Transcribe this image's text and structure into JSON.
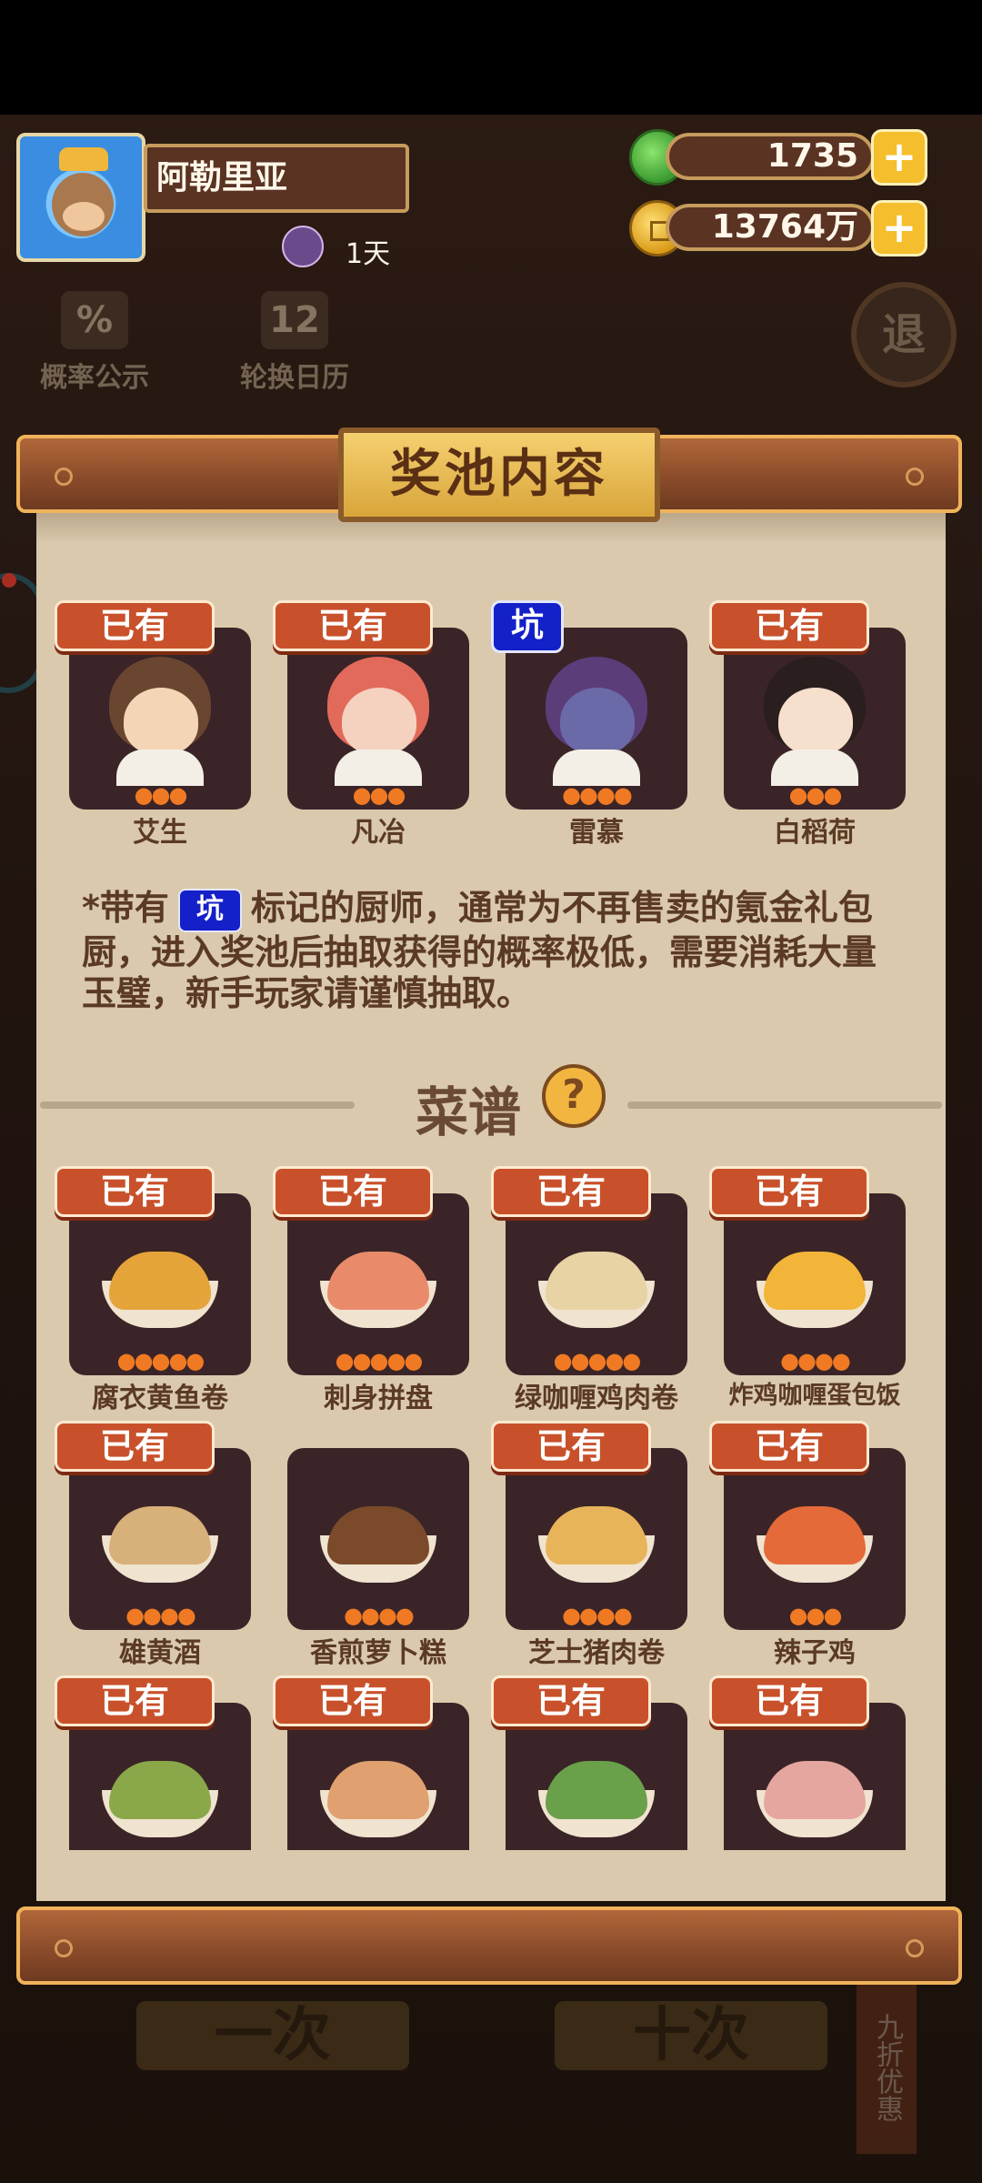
{
  "header": {
    "player_name": "阿勒里亚",
    "days": "1天",
    "jade_amount": "1735",
    "coin_amount": "13764万",
    "plus_symbol": "+"
  },
  "shortcuts": [
    {
      "label": "概率公示",
      "icon": "%"
    },
    {
      "label": "轮换日历",
      "icon": "12"
    }
  ],
  "exit_label": "退",
  "panel": {
    "title": "奖池内容",
    "chef_cards": [
      {
        "name": "艾生",
        "tag": "已有",
        "stars": "●●●"
      },
      {
        "name": "凡冶",
        "tag": "已有",
        "stars": "●●●"
      },
      {
        "name": "雷慕",
        "tag": "坑",
        "stars": "●●●●"
      },
      {
        "name": "白稻荷",
        "tag": "已有",
        "stars": "●●●"
      }
    ],
    "note_parts": [
      "*带有",
      "坑",
      "标记的厨师，通常为不再售卖的氪金礼包厨，进入奖池后抽取获得的概率极低，需要消耗大量玉璧，新手玩家请谨慎抽取。"
    ],
    "section_title": "菜谱",
    "help_symbol": "?",
    "recipes": [
      {
        "name": "腐衣黄鱼卷",
        "tag": "已有",
        "stars": "●●●●●",
        "color": "#e5a43a"
      },
      {
        "name": "刺身拼盘",
        "tag": "已有",
        "stars": "●●●●●",
        "color": "#e98b6a"
      },
      {
        "name": "绿咖喱鸡肉卷",
        "tag": "已有",
        "stars": "●●●●●",
        "color": "#e7d3a4"
      },
      {
        "name": "炸鸡咖喱蛋包饭",
        "tag": "已有",
        "stars": "●●●●",
        "color": "#f2b53a"
      },
      {
        "name": "雄黄酒",
        "tag": "已有",
        "stars": "●●●●",
        "color": "#d8b07a"
      },
      {
        "name": "香煎萝卜糕",
        "tag": "",
        "stars": "●●●●",
        "color": "#7a4a2a"
      },
      {
        "name": "芝士猪肉卷",
        "tag": "已有",
        "stars": "●●●●",
        "color": "#e8b45a"
      },
      {
        "name": "辣子鸡",
        "tag": "已有",
        "stars": "●●●",
        "color": "#e46a3a"
      },
      {
        "name": "",
        "tag": "已有",
        "stars": "",
        "color": "#8aa84a"
      },
      {
        "name": "",
        "tag": "已有",
        "stars": "",
        "color": "#e0a070"
      },
      {
        "name": "",
        "tag": "已有",
        "stars": "",
        "color": "#6aa04a"
      },
      {
        "name": "",
        "tag": "已有",
        "stars": "",
        "color": "#e6a6a0"
      }
    ]
  },
  "bottom": {
    "single_draw": "一次",
    "ten_draw": "十次",
    "discount": "九折优惠"
  },
  "colors": {
    "owned_tag": "#c8512b",
    "pit_tag": "#1420c8",
    "panel_bg": "#dac9ac",
    "card_bg": "#3a2427"
  }
}
